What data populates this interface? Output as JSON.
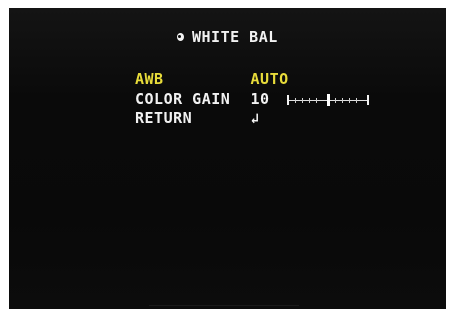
{
  "menu": {
    "title": "WHITE BAL",
    "title_icon": "sun-dot-icon",
    "items": [
      {
        "label": "AWB",
        "value": "AUTO",
        "selected": true
      },
      {
        "label": "COLOR GAIN",
        "value": "10",
        "slider_level": 0.5
      },
      {
        "label": "RETURN",
        "value": "↲"
      }
    ]
  },
  "colors": {
    "highlight": "#e8dc3a",
    "text": "#f2f2f2",
    "background": "#0a0a0a"
  }
}
